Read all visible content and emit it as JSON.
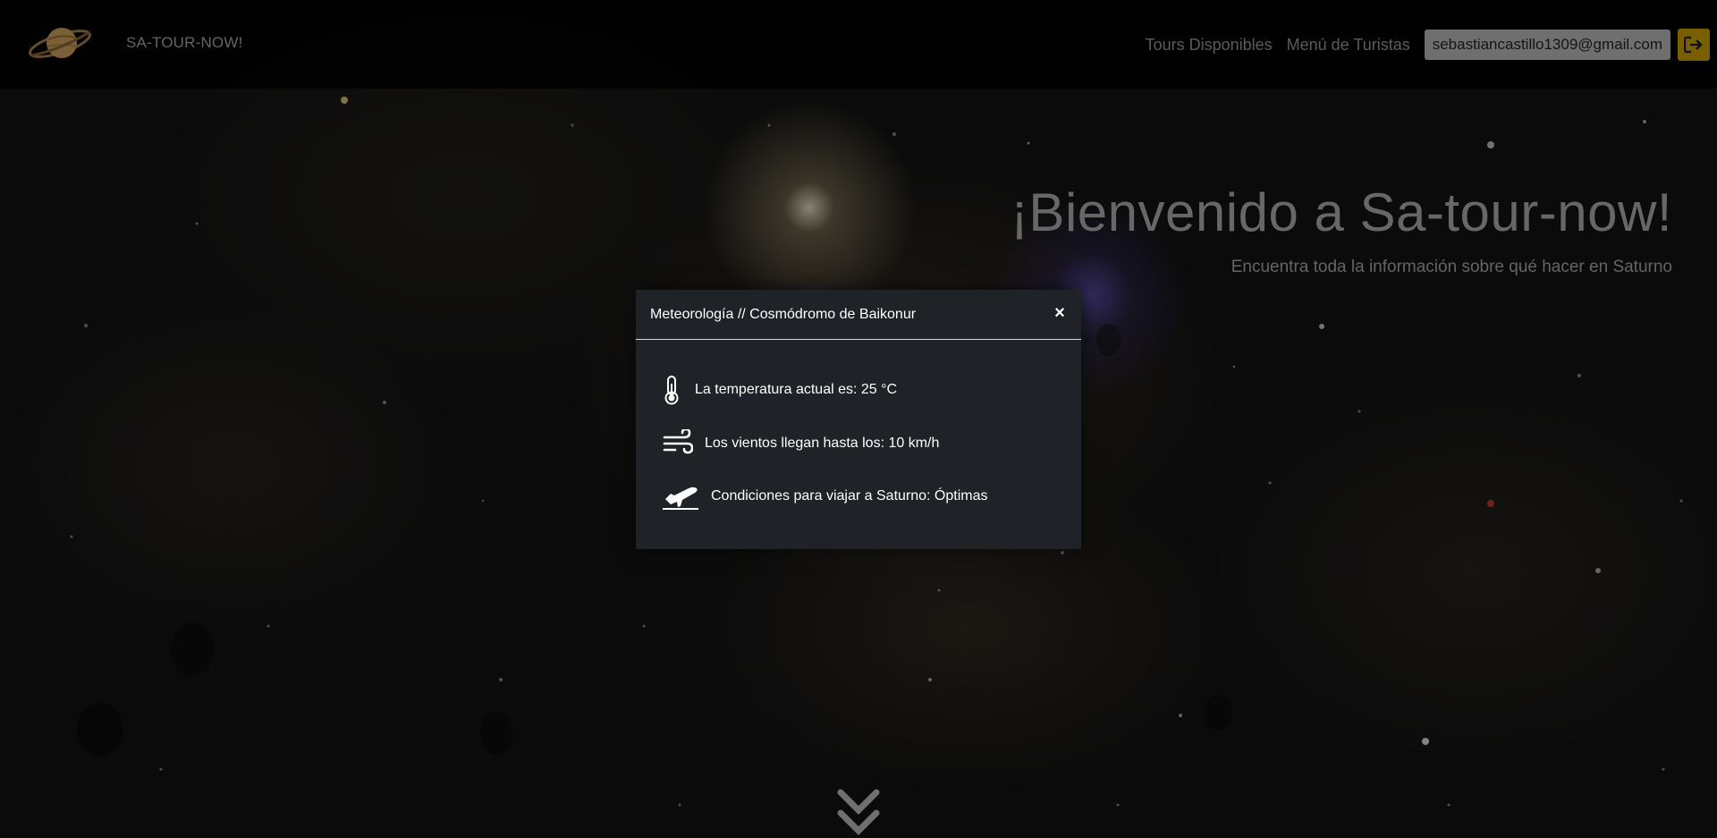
{
  "navbar": {
    "brand": "SA-TOUR-NOW!",
    "links": [
      "Tours Disponibles",
      "Menú de Turistas"
    ],
    "user_email": "sebastiancastillo1309@gmail.com"
  },
  "hero": {
    "title": "¡Bienvenido a Sa-tour-now!",
    "subtitle": "Encuentra toda la información sobre qué hacer en Saturno"
  },
  "modal": {
    "title": "Meteorología // Cosmódromo de Baikonur",
    "close_symbol": "×",
    "rows": [
      {
        "icon": "thermometer-icon",
        "text": "La temperatura actual es: 25 °C"
      },
      {
        "icon": "wind-icon",
        "text": "Los vientos llegan hasta los: 10 km/h"
      },
      {
        "icon": "plane-departure-icon",
        "text": "Condiciones para viajar a Saturno: Óptimas"
      }
    ]
  },
  "colors": {
    "logout_button": "#a98400",
    "modal_background": "#1f2226",
    "navbar_background": "#000000"
  }
}
